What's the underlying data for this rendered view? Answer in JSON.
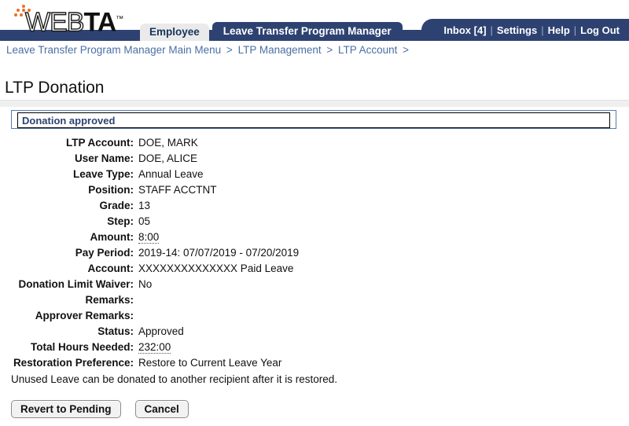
{
  "header": {
    "logo": {
      "part1": "WEB",
      "part2": "TA",
      "tm": "™"
    },
    "tabs": [
      {
        "label": "Employee",
        "active": false
      },
      {
        "label": "Leave Transfer Program Manager",
        "active": true
      }
    ],
    "utility_links": [
      {
        "label": "Inbox [4]"
      },
      {
        "label": "Settings"
      },
      {
        "label": "Help"
      },
      {
        "label": "Log Out"
      }
    ],
    "separator": "|"
  },
  "breadcrumb": {
    "items": [
      "Leave Transfer Program Manager Main Menu",
      "LTP Management",
      "LTP Account"
    ],
    "separator": ">",
    "trailing_separator": ">"
  },
  "page": {
    "title": "LTP Donation"
  },
  "message": {
    "text": "Donation approved"
  },
  "form": {
    "rows": [
      {
        "label": "LTP Account:",
        "value": "DOE, MARK",
        "dotted": false
      },
      {
        "label": "User Name:",
        "value": "DOE, ALICE",
        "dotted": false
      },
      {
        "label": "Leave Type:",
        "value": "Annual Leave",
        "dotted": false
      },
      {
        "label": "Position:",
        "value": "STAFF ACCTNT",
        "dotted": false
      },
      {
        "label": "Grade:",
        "value": "13",
        "dotted": false
      },
      {
        "label": "Step:",
        "value": "05",
        "dotted": false
      },
      {
        "label": "Amount:",
        "value": "8:00",
        "dotted": true
      },
      {
        "label": "Pay Period:",
        "value": "2019-14: 07/07/2019 - 07/20/2019",
        "dotted": false
      },
      {
        "label": "Account:",
        "value": "XXXXXXXXXXXXXX Paid Leave",
        "dotted": false
      },
      {
        "label": "Donation Limit Waiver:",
        "value": "No",
        "dotted": false
      },
      {
        "label": "Remarks:",
        "value": "",
        "dotted": false
      },
      {
        "label": "Approver Remarks:",
        "value": "",
        "dotted": false
      },
      {
        "label": "Status:",
        "value": "Approved",
        "dotted": false
      },
      {
        "label": "Total Hours Needed:",
        "value": "232:00",
        "dotted": true
      },
      {
        "label": "Restoration Preference:",
        "value": "Restore to Current Leave Year",
        "dotted": false
      }
    ]
  },
  "note": {
    "text": "Unused Leave can be donated to another recipient after it is restored."
  },
  "buttons": [
    {
      "label": "Revert to Pending",
      "name": "revert-to-pending-button"
    },
    {
      "label": "Cancel",
      "name": "cancel-button"
    }
  ],
  "colors": {
    "navy": "#2e4272",
    "orange": "#e8712a",
    "breadcrumb_link": "#4a6fa5",
    "message_text": "#2e4272"
  }
}
